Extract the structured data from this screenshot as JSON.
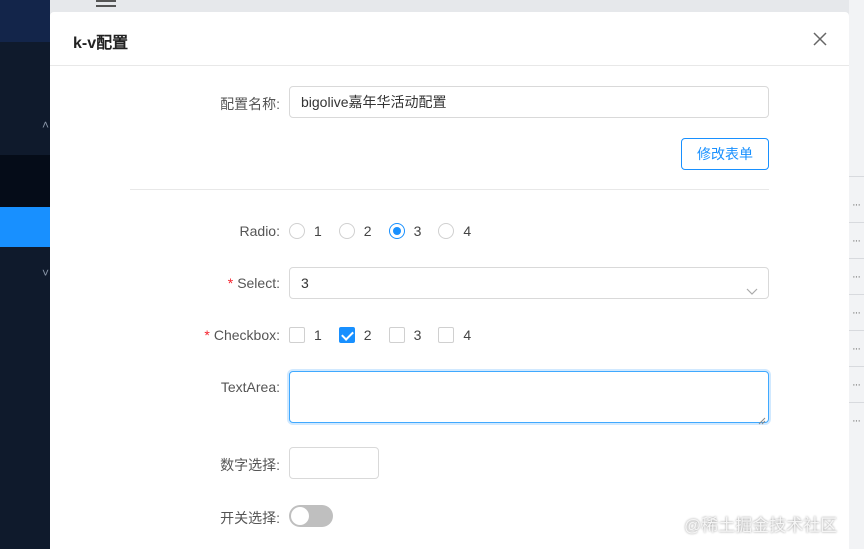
{
  "modal": {
    "title": "k-v配置",
    "close_icon": "close-icon"
  },
  "form": {
    "config_name": {
      "label": "配置名称",
      "value": "bigolive嘉年华活动配置"
    },
    "edit_button": "修改表单",
    "radio": {
      "label": "Radio",
      "options": [
        "1",
        "2",
        "3",
        "4"
      ],
      "selected": "3"
    },
    "select": {
      "label": "Select",
      "required_mark": "*",
      "value": "3",
      "icon": "chevron-down-icon"
    },
    "checkbox": {
      "label": "Checkbox",
      "required_mark": "*",
      "options": [
        "1",
        "2",
        "3",
        "4"
      ],
      "checked": [
        "2"
      ]
    },
    "textarea": {
      "label": "TextArea",
      "value": ""
    },
    "number": {
      "label": "数字选择",
      "value": ""
    },
    "switch": {
      "label": "开关选择",
      "on": false
    }
  },
  "colors": {
    "accent": "#1890ff",
    "required": "#f5222d",
    "sidebar": "#0f1a2c"
  },
  "watermark": "@稀土掘金技术社区"
}
